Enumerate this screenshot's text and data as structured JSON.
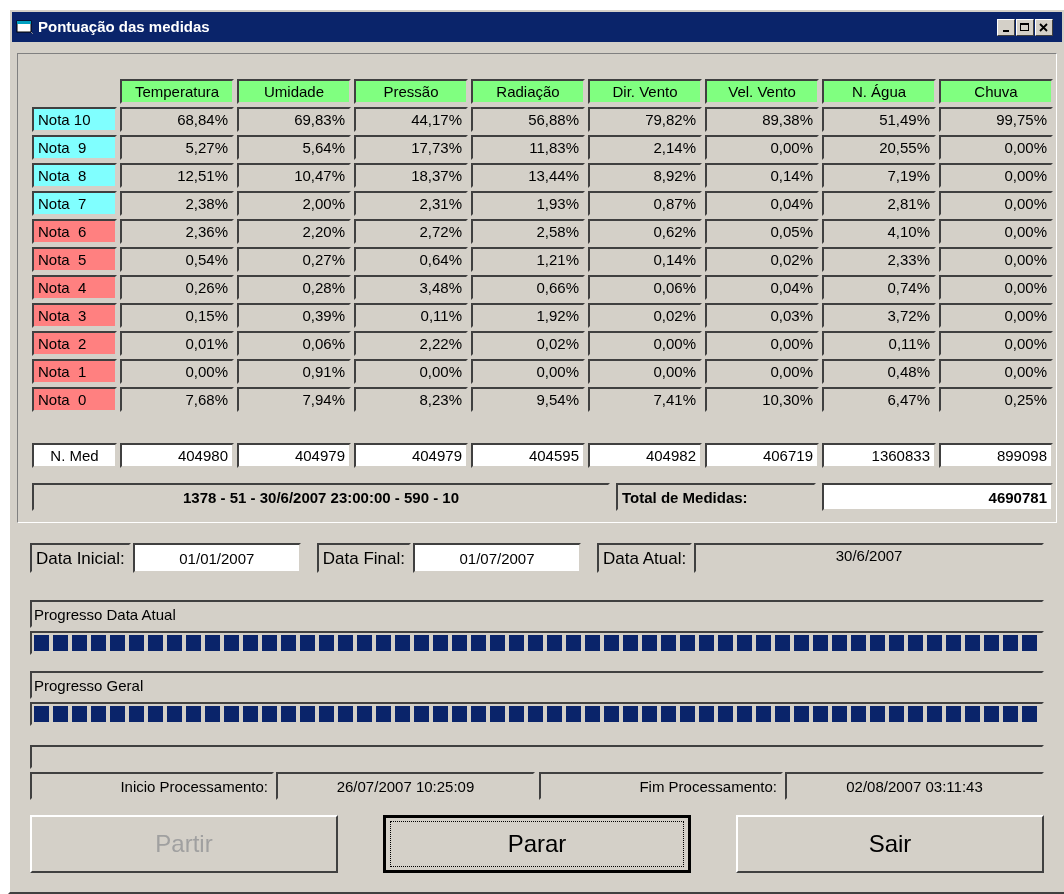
{
  "window": {
    "title": "Pontuação das medidas"
  },
  "table": {
    "columns": [
      "Temperatura",
      "Umidade",
      "Pressão",
      "Radiação",
      "Dir. Vento",
      "Vel. Vento",
      "N. Água",
      "Chuva"
    ],
    "rows": [
      {
        "label": "Nota 10",
        "color": "#80ffff",
        "values": [
          "68,84%",
          "69,83%",
          "44,17%",
          "56,88%",
          "79,82%",
          "89,38%",
          "51,49%",
          "99,75%"
        ]
      },
      {
        "label": "Nota  9",
        "color": "#80ffff",
        "values": [
          "5,27%",
          "5,64%",
          "17,73%",
          "11,83%",
          "2,14%",
          "0,00%",
          "20,55%",
          "0,00%"
        ]
      },
      {
        "label": "Nota  8",
        "color": "#80ffff",
        "values": [
          "12,51%",
          "10,47%",
          "18,37%",
          "13,44%",
          "8,92%",
          "0,14%",
          "7,19%",
          "0,00%"
        ]
      },
      {
        "label": "Nota  7",
        "color": "#80ffff",
        "values": [
          "2,38%",
          "2,00%",
          "2,31%",
          "1,93%",
          "0,87%",
          "0,04%",
          "2,81%",
          "0,00%"
        ]
      },
      {
        "label": "Nota  6",
        "color": "#ff8080",
        "values": [
          "2,36%",
          "2,20%",
          "2,72%",
          "2,58%",
          "0,62%",
          "0,05%",
          "4,10%",
          "0,00%"
        ]
      },
      {
        "label": "Nota  5",
        "color": "#ff8080",
        "values": [
          "0,54%",
          "0,27%",
          "0,64%",
          "1,21%",
          "0,14%",
          "0,02%",
          "2,33%",
          "0,00%"
        ]
      },
      {
        "label": "Nota  4",
        "color": "#ff8080",
        "values": [
          "0,26%",
          "0,28%",
          "3,48%",
          "0,66%",
          "0,06%",
          "0,04%",
          "0,74%",
          "0,00%"
        ]
      },
      {
        "label": "Nota  3",
        "color": "#ff8080",
        "values": [
          "0,15%",
          "0,39%",
          "0,11%",
          "1,92%",
          "0,02%",
          "0,03%",
          "3,72%",
          "0,00%"
        ]
      },
      {
        "label": "Nota  2",
        "color": "#ff8080",
        "values": [
          "0,01%",
          "0,06%",
          "2,22%",
          "0,02%",
          "0,00%",
          "0,00%",
          "0,11%",
          "0,00%"
        ]
      },
      {
        "label": "Nota  1",
        "color": "#ff8080",
        "values": [
          "0,00%",
          "0,91%",
          "0,00%",
          "0,00%",
          "0,00%",
          "0,00%",
          "0,48%",
          "0,00%"
        ]
      },
      {
        "label": "Nota  0",
        "color": "#ff8080",
        "values": [
          "7,68%",
          "7,94%",
          "8,23%",
          "9,54%",
          "7,41%",
          "10,30%",
          "6,47%",
          "0,25%"
        ]
      }
    ],
    "totals": {
      "label": "N. Med",
      "values": [
        "404980",
        "404979",
        "404979",
        "404595",
        "404982",
        "406719",
        "1360833",
        "899098"
      ]
    }
  },
  "info": {
    "current": "1378 - 51 - 30/6/2007 23:00:00 - 590 - 10",
    "total_label": "Total de Medidas:",
    "total_value": "4690781"
  },
  "dates": [
    {
      "label": "Data Inicial:",
      "value": "01/01/2007",
      "editable": true
    },
    {
      "label": "Data Final:",
      "value": "01/07/2007",
      "editable": true
    },
    {
      "label": "Data Atual:",
      "value": "30/6/2007",
      "editable": false
    }
  ],
  "progress": [
    {
      "label": "Progresso Data Atual",
      "level": 1
    },
    {
      "label": "Progresso Geral",
      "level": 1
    }
  ],
  "processing": [
    {
      "label": "Inicio Processamento:",
      "value": "26/07/2007 10:25:09"
    },
    {
      "label": "Fim Processamento:",
      "value": "02/08/2007 03:11:43"
    }
  ],
  "buttons": [
    {
      "label": "Partir",
      "disabled": true,
      "focused": false
    },
    {
      "label": "Parar",
      "disabled": false,
      "focused": true
    },
    {
      "label": "Sair",
      "disabled": false,
      "focused": false
    }
  ]
}
